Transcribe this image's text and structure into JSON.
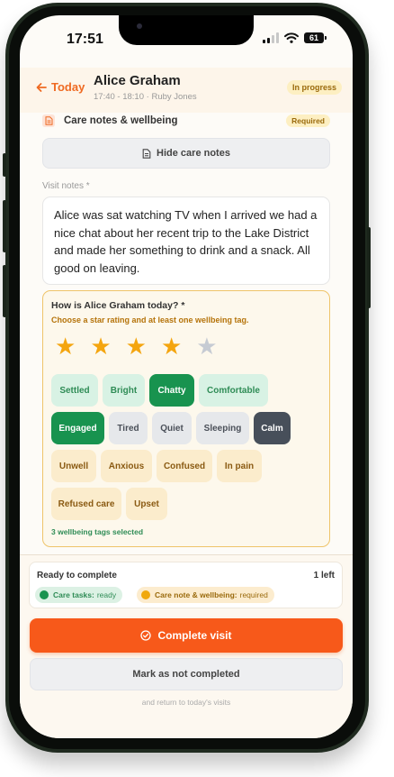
{
  "status_bar": {
    "time": "17:51",
    "battery": "61"
  },
  "header": {
    "back_label": "Today",
    "client_name": "Alice Graham",
    "visit_time": "17:40 - 18:10",
    "carer": "Ruby Jones",
    "status": "In progress"
  },
  "care_notes": {
    "section_title": "Care notes & wellbeing",
    "required_badge": "Required",
    "hide_button": "Hide care notes",
    "visit_notes_label": "Visit notes *",
    "visit_notes_value": "Alice was sat watching TV when I arrived we had a nice chat about her recent trip to the Lake District and made her something to drink and a snack. All good on leaving."
  },
  "wellbeing": {
    "question": "How is Alice Graham today? *",
    "hint": "Choose a star rating and at least one wellbeing tag.",
    "rating": 4,
    "max_rating": 5,
    "tags": [
      {
        "label": "Settled",
        "tone": "positive",
        "selected": false
      },
      {
        "label": "Bright",
        "tone": "positive",
        "selected": false
      },
      {
        "label": "Chatty",
        "tone": "positive",
        "selected": true
      },
      {
        "label": "Comfortable",
        "tone": "positive",
        "selected": false
      },
      {
        "label": "Engaged",
        "tone": "positive",
        "selected": true
      },
      {
        "label": "Tired",
        "tone": "neutral",
        "selected": false
      },
      {
        "label": "Quiet",
        "tone": "neutral",
        "selected": false
      },
      {
        "label": "Sleeping",
        "tone": "neutral",
        "selected": false
      },
      {
        "label": "Calm",
        "tone": "neutral",
        "selected": true
      },
      {
        "label": "Unwell",
        "tone": "concern",
        "selected": false
      },
      {
        "label": "Anxious",
        "tone": "concern",
        "selected": false
      },
      {
        "label": "Confused",
        "tone": "concern",
        "selected": false
      },
      {
        "label": "In pain",
        "tone": "concern",
        "selected": false
      },
      {
        "label": "Refused care",
        "tone": "concern",
        "selected": false
      },
      {
        "label": "Upset",
        "tone": "concern",
        "selected": false
      }
    ],
    "selected_count_text": "3 wellbeing tags selected"
  },
  "completion": {
    "title": "Ready to complete",
    "remaining": "1 left",
    "care_tasks_label": "Care tasks:",
    "care_tasks_status": "ready",
    "care_note_label": "Care note & wellbeing:",
    "care_note_status": "required",
    "complete_button": "Complete visit",
    "not_completed_button": "Mark as not completed",
    "return_text": "and return to today's visits"
  },
  "colors": {
    "accent": "#f7591a",
    "positive": "#18934f",
    "warning": "#f0a80d",
    "star": "#f4a50f"
  }
}
